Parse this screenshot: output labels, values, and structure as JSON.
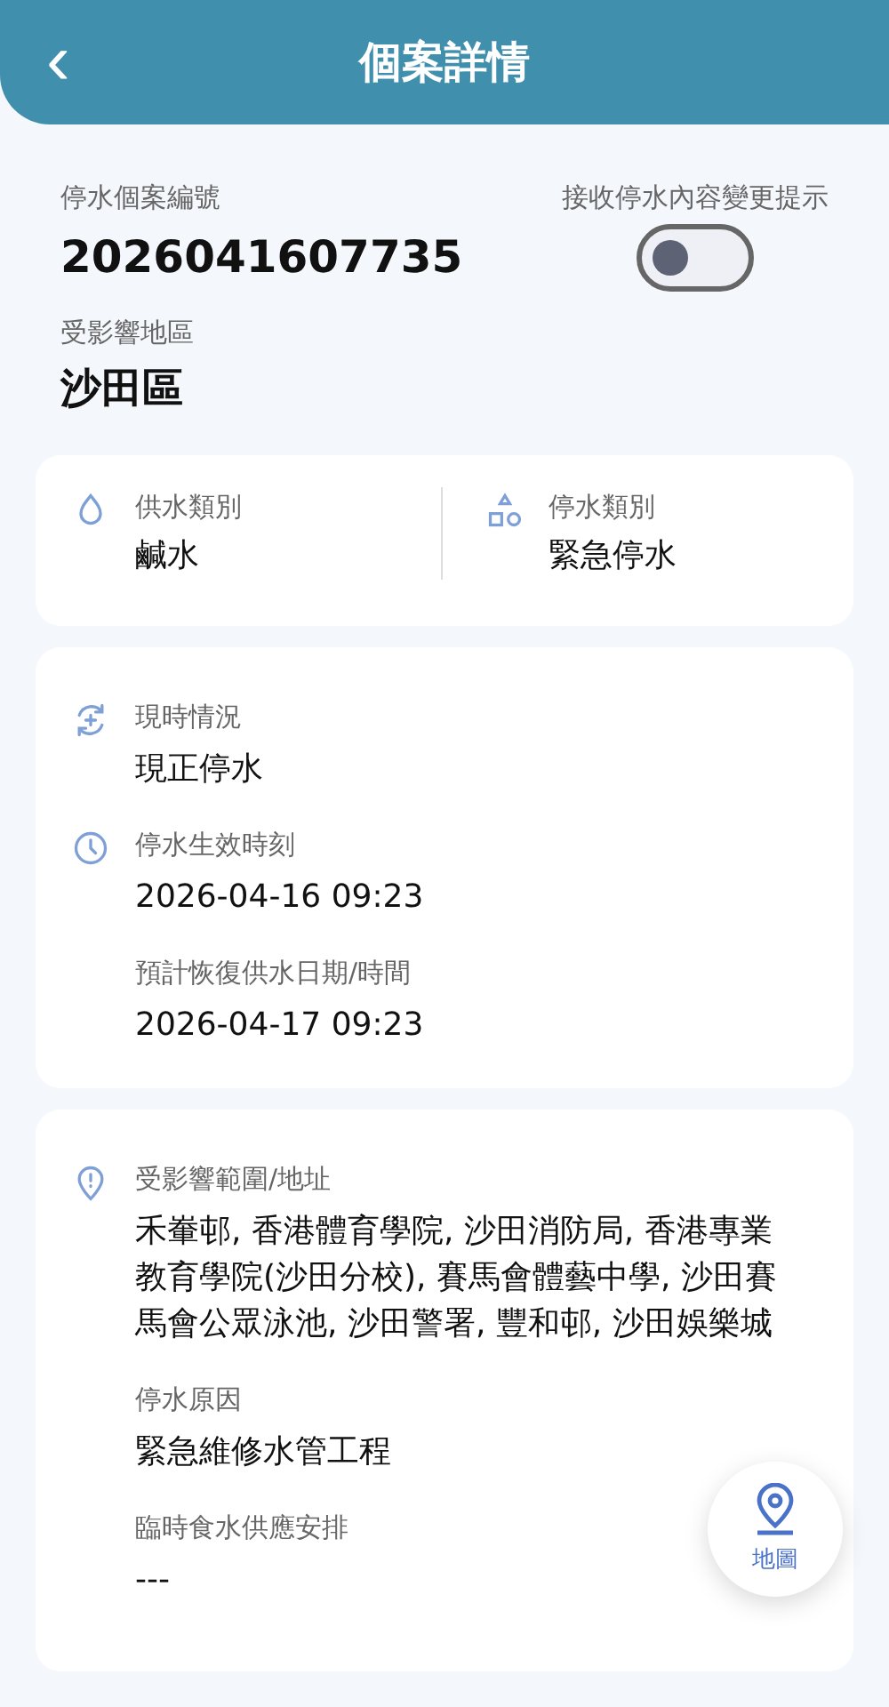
{
  "header": {
    "back_icon": "‹",
    "title": "個案詳情"
  },
  "case": {
    "label": "停水個案編號",
    "number": "2026041607735"
  },
  "notify": {
    "label": "接收停水內容變更提示",
    "on": false
  },
  "district": {
    "label": "受影響地區",
    "value": "沙田區"
  },
  "types": [
    {
      "label": "供水類別",
      "value": "鹹水"
    },
    {
      "label": "停水類別",
      "value": "緊急停水"
    }
  ],
  "timing": [
    {
      "label": "現時情況",
      "value": "現正停水"
    },
    {
      "label": "停水生效時刻",
      "value": "2026-04-16 09:23"
    },
    {
      "label": "預計恢復供水日期/時間",
      "value": "2026-04-17 09:23"
    }
  ],
  "details": [
    {
      "label": "受影響範圍/地址",
      "value": "禾輋邨, 香港體育學院, 沙田消防局, 香港專業教育學院(沙田分校), 賽馬會體藝中學, 沙田賽馬會公眾泳池, 沙田警署, 豐和邨, 沙田娛樂城"
    },
    {
      "label": "停水原因",
      "value": "緊急維修水管工程"
    },
    {
      "label": "臨時食水供應安排",
      "value": "---"
    }
  ],
  "map_button": {
    "label": "地圖"
  }
}
